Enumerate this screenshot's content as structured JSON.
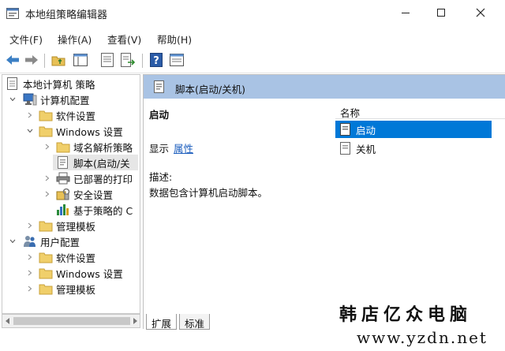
{
  "window": {
    "title": "本地组策略编辑器"
  },
  "menu": [
    "文件(F)",
    "操作(A)",
    "查看(V)",
    "帮助(H)"
  ],
  "toolbar": {
    "icons": [
      "back-arrow-icon",
      "forward-arrow-icon",
      "up-folder-icon",
      "show-tree-icon",
      "properties-icon",
      "export-list-icon",
      "help-icon",
      "view-icon"
    ]
  },
  "tree": {
    "items": [
      {
        "label": "本地计算机 策略"
      },
      {
        "label": "计算机配置"
      },
      {
        "label": "软件设置"
      },
      {
        "label": "Windows 设置"
      },
      {
        "label": "域名解析策略"
      },
      {
        "label": "脚本(启动/关"
      },
      {
        "label": "已部署的打印"
      },
      {
        "label": "安全设置"
      },
      {
        "label": "基于策略的 C"
      },
      {
        "label": "管理模板"
      },
      {
        "label": "用户配置"
      },
      {
        "label": "软件设置"
      },
      {
        "label": "Windows 设置"
      },
      {
        "label": "管理模板"
      }
    ]
  },
  "details": {
    "header": "脚本(启动/关机)",
    "section_title": "启动",
    "show_label": "显示",
    "properties_link": "属性",
    "description_label": "描述:",
    "description_text": "数据包含计算机启动脚本。"
  },
  "list": {
    "column": "名称",
    "items": [
      {
        "label": "启动",
        "selected": true
      },
      {
        "label": "关机",
        "selected": false
      }
    ]
  },
  "tabs": [
    "扩展",
    "标准"
  ],
  "watermark": {
    "line1": "韩店亿众电脑",
    "line2": "www.yzdn.net"
  },
  "colors": {
    "header_bg": "#a9c3e4",
    "selection": "#0078d7",
    "link": "#1b5dbd"
  }
}
